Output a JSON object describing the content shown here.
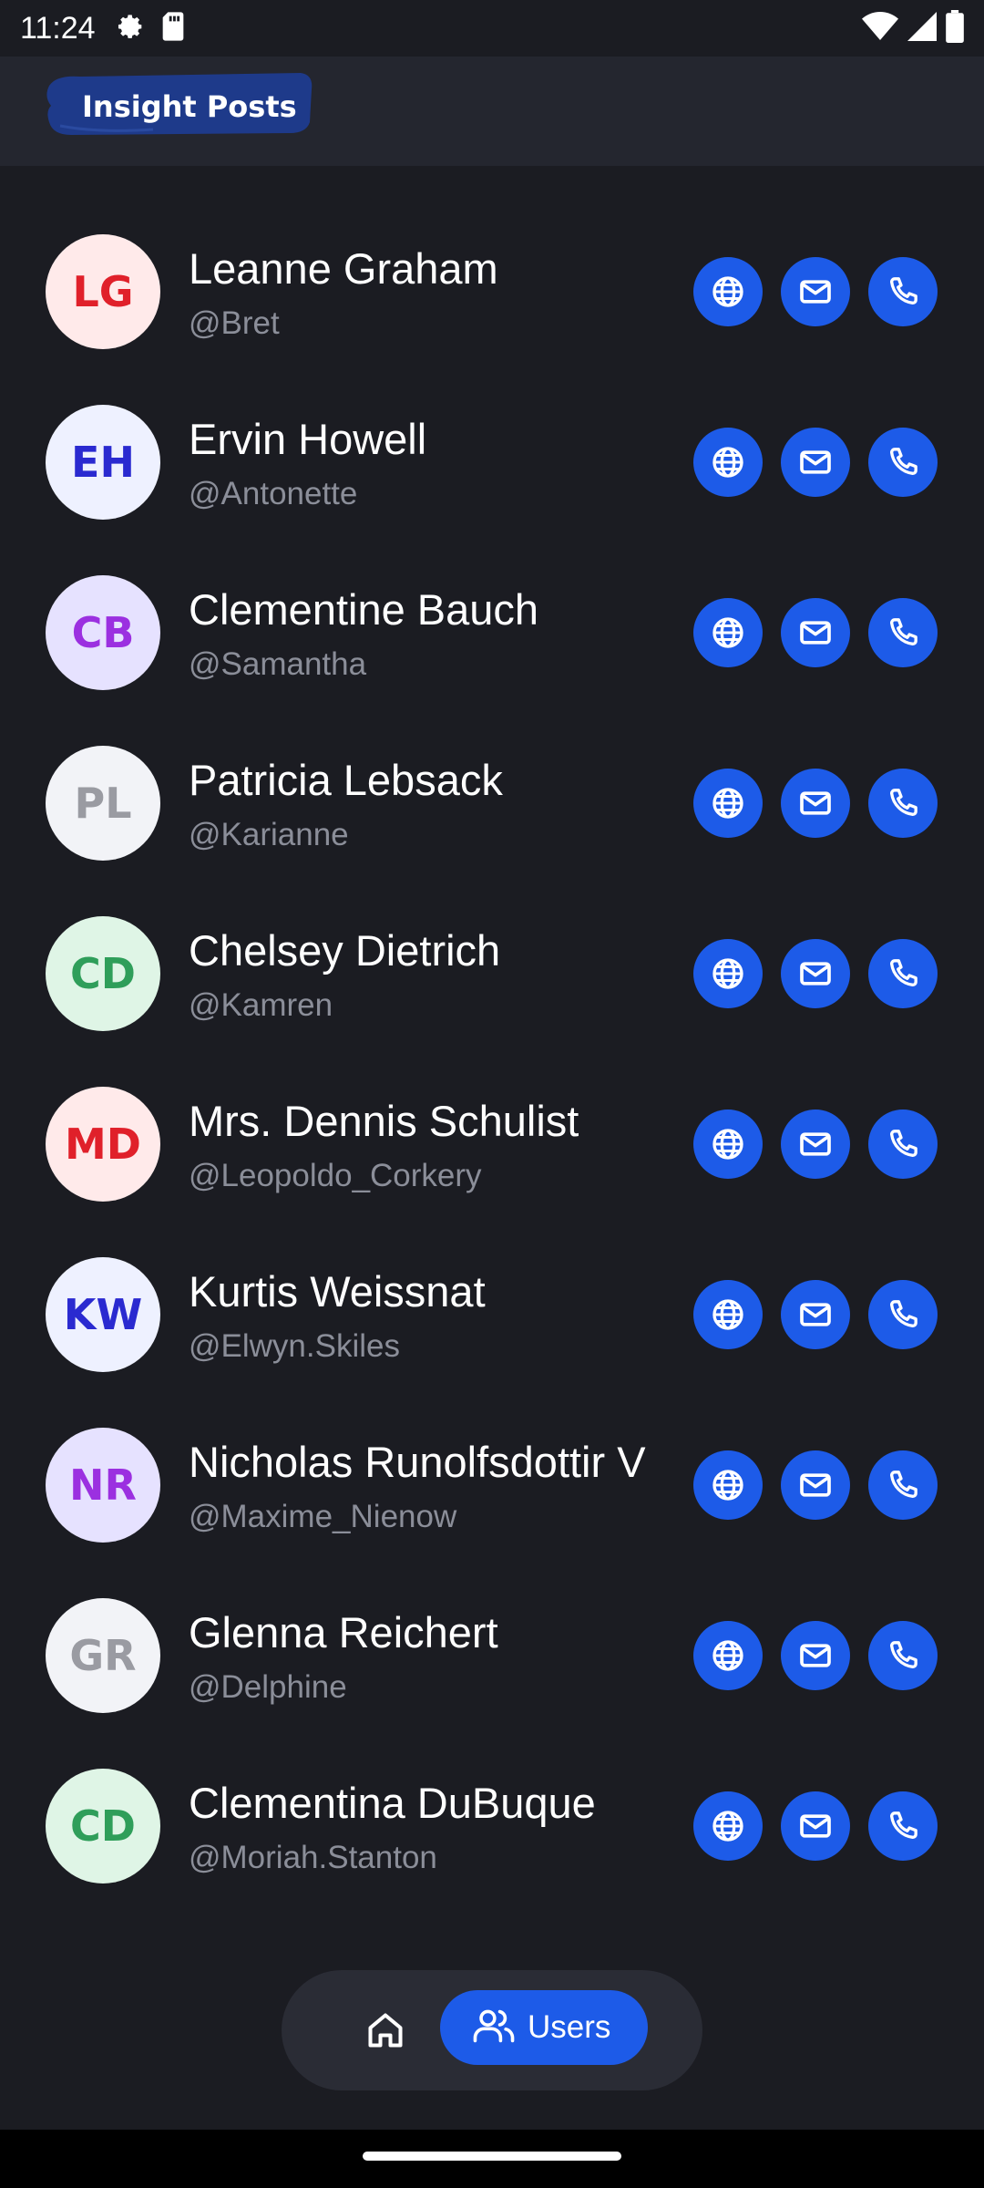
{
  "status_bar": {
    "time": "11:24",
    "icons": [
      "settings-icon",
      "sim-card-icon",
      "wifi-icon",
      "signal-icon",
      "battery-icon"
    ]
  },
  "app_bar": {
    "title": "Insight Posts"
  },
  "users": [
    {
      "initials": "LG",
      "name": "Leanne Graham",
      "handle": "@Bret",
      "avatar_bg": "#ffeaea",
      "avatar_fg": "#e0202a"
    },
    {
      "initials": "EH",
      "name": "Ervin Howell",
      "handle": "@Antonette",
      "avatar_bg": "#eef1ff",
      "avatar_fg": "#2a2ad0"
    },
    {
      "initials": "CB",
      "name": "Clementine Bauch",
      "handle": "@Samantha",
      "avatar_bg": "#e6e2ff",
      "avatar_fg": "#9b30e0"
    },
    {
      "initials": "PL",
      "name": "Patricia Lebsack",
      "handle": "@Karianne",
      "avatar_bg": "#f2f3f7",
      "avatar_fg": "#9a9ba2"
    },
    {
      "initials": "CD",
      "name": "Chelsey Dietrich",
      "handle": "@Kamren",
      "avatar_bg": "#dff5e6",
      "avatar_fg": "#2f9e5a"
    },
    {
      "initials": "MD",
      "name": "Mrs. Dennis Schulist",
      "handle": "@Leopoldo_Corkery",
      "avatar_bg": "#ffeaea",
      "avatar_fg": "#e0202a"
    },
    {
      "initials": "KW",
      "name": "Kurtis Weissnat",
      "handle": "@Elwyn.Skiles",
      "avatar_bg": "#eef1ff",
      "avatar_fg": "#2a2ad0"
    },
    {
      "initials": "NR",
      "name": "Nicholas Runolfsdottir V",
      "handle": "@Maxime_Nienow",
      "avatar_bg": "#e6e2ff",
      "avatar_fg": "#9b30e0"
    },
    {
      "initials": "GR",
      "name": "Glenna Reichert",
      "handle": "@Delphine",
      "avatar_bg": "#f2f3f7",
      "avatar_fg": "#9a9ba2"
    },
    {
      "initials": "CD",
      "name": "Clementina DuBuque",
      "handle": "@Moriah.Stanton",
      "avatar_bg": "#dff5e6",
      "avatar_fg": "#2f9e5a"
    }
  ],
  "row_actions": [
    "globe-icon",
    "mail-icon",
    "phone-icon"
  ],
  "bottom_nav": {
    "home_icon": "home-icon",
    "users_icon": "users-icon",
    "users_label": "Users",
    "active_tab": "Users"
  },
  "colors": {
    "background": "#1b1c22",
    "app_bar": "#24262f",
    "accent": "#1d5be8",
    "handle_text": "#8b8e99",
    "brand_brush": "#1e3a8a"
  }
}
